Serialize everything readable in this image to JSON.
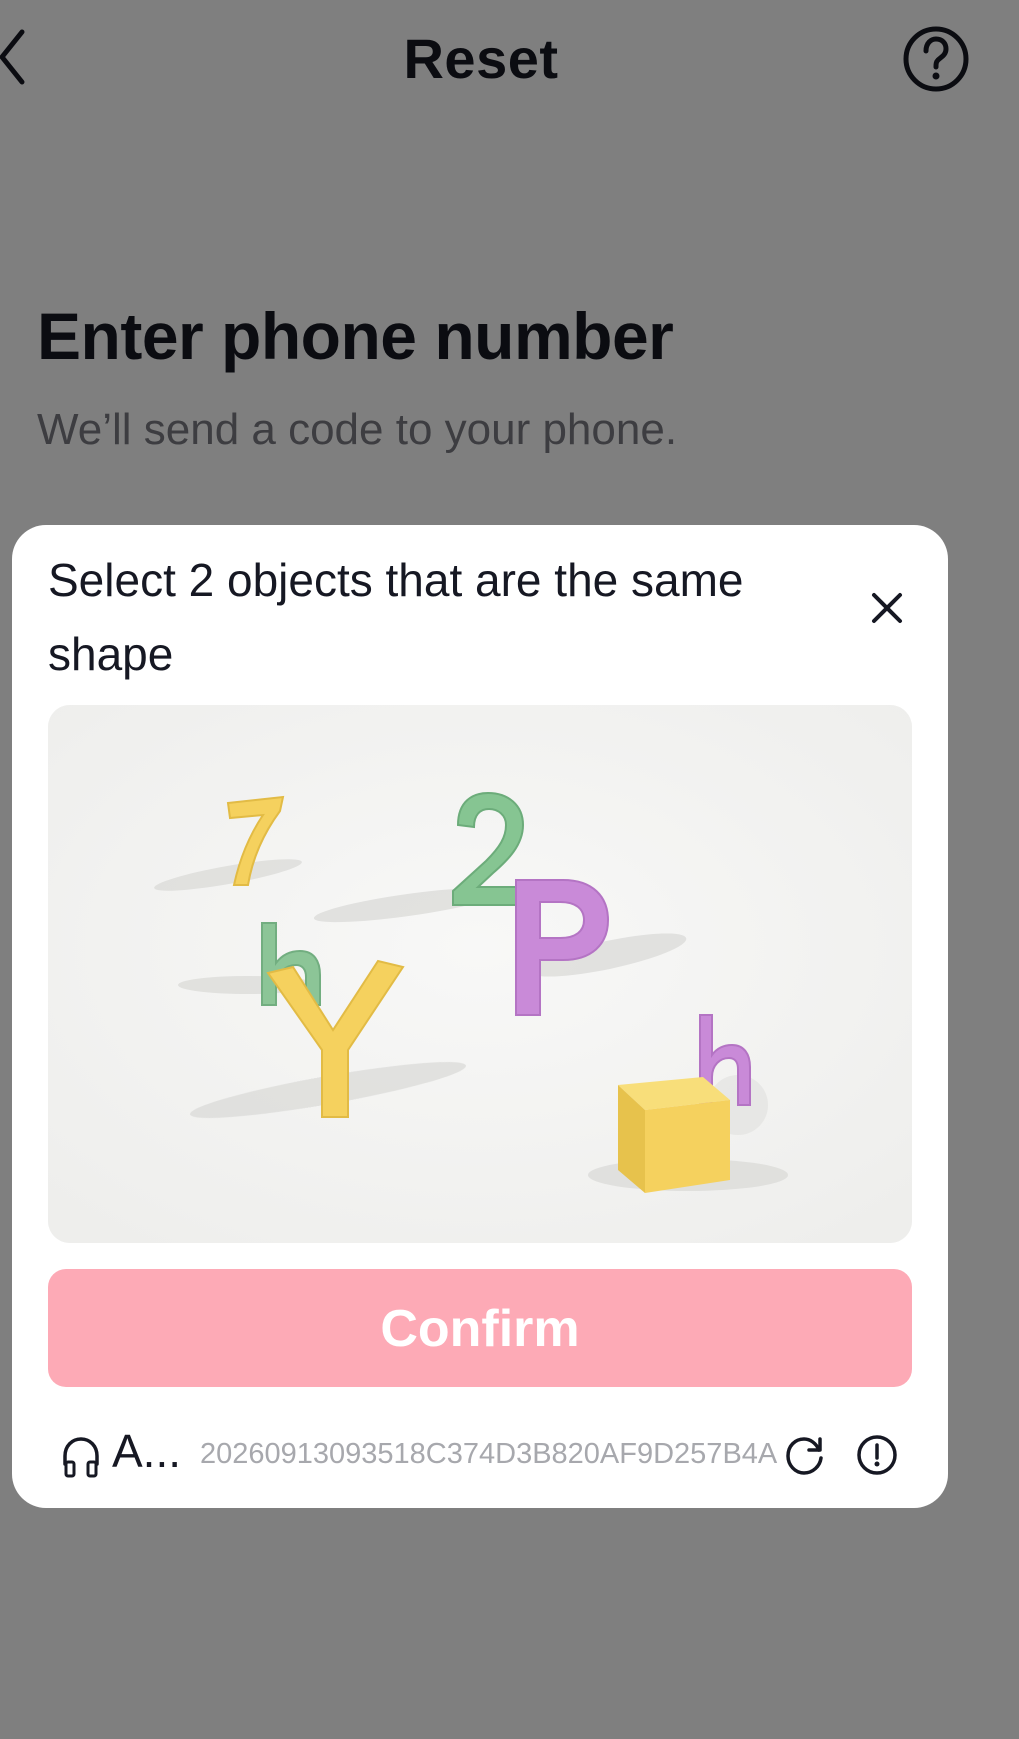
{
  "header": {
    "title": "Reset",
    "back_icon": "chevron-left-icon",
    "help_icon": "question-circle-icon"
  },
  "main": {
    "heading": "Enter phone number",
    "subheading": "We’ll send a code to your phone."
  },
  "captcha": {
    "prompt": "Select 2 objects that are the same shape",
    "close_icon": "close-icon",
    "image_objects": [
      "7",
      "2",
      "h",
      "P",
      "Y",
      "h",
      "cube"
    ],
    "confirm_label": "Confirm",
    "audio_icon": "headphones-icon",
    "audio_label": "A...",
    "captcha_id": "20260913093518C374D3B820AF9D257B4A",
    "refresh_icon": "refresh-icon",
    "report_icon": "info-circle-icon",
    "colors": {
      "confirm_bg": "#fdaab6",
      "yellow": "#f5d15e",
      "green": "#7cc08a",
      "purple": "#c98ad8"
    }
  }
}
